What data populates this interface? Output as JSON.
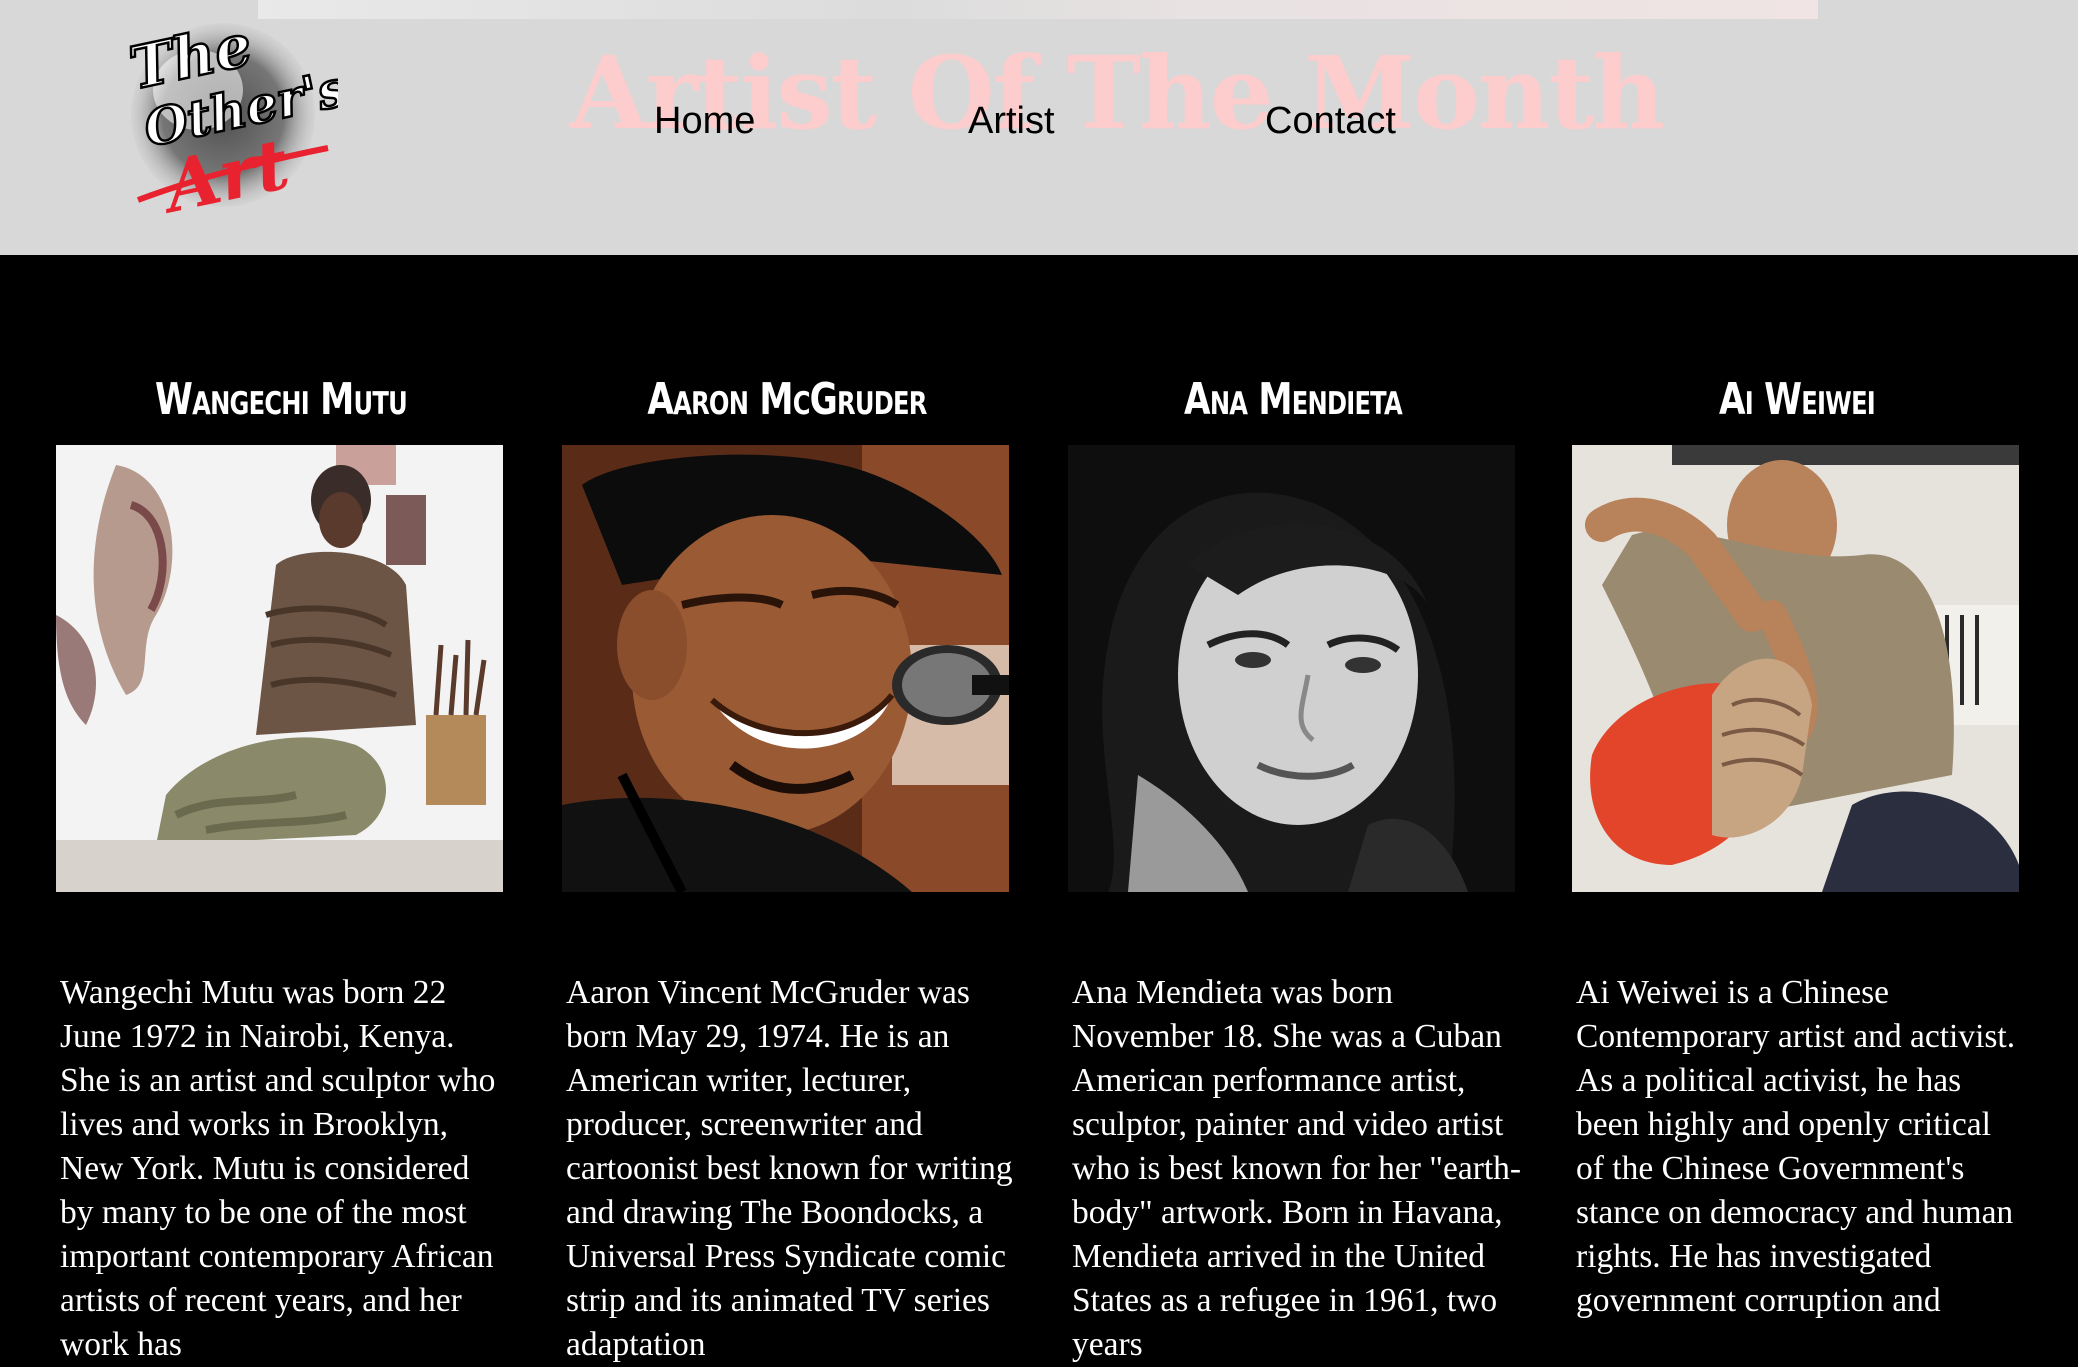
{
  "site": {
    "logo_text": [
      "The",
      "Other's",
      "Art"
    ],
    "ghost_title": "Artist Of The Month"
  },
  "nav": {
    "items": [
      {
        "label": "Home"
      },
      {
        "label": "Artist"
      },
      {
        "label": "Contact"
      }
    ]
  },
  "artists": [
    {
      "name": "Wangechi Mutu",
      "photo_icon": "portrait-photo",
      "bio": "Wangechi Mutu was born 22 June 1972 in Nairobi, Kenya. She is an artist and sculptor who lives and works in Brooklyn, New York. Mutu is considered by many to be one of the most important contemporary African artists of recent years, and her work has"
    },
    {
      "name": "Aaron McGruder",
      "photo_icon": "portrait-photo",
      "bio": "Aaron Vincent McGruder was born May 29, 1974. He is an American writer, lecturer, producer, screenwriter and cartoonist best known for writing and drawing The Boondocks, a Universal Press Syndicate comic strip and its animated TV series adaptation"
    },
    {
      "name": "Ana Mendieta",
      "photo_icon": "portrait-photo",
      "bio": "Ana Mendieta was born November 18. She was a Cuban American performance artist, sculptor, painter and video artist who is best known for her \"earth-body\" artwork. Born in Havana, Mendieta arrived in the United States as a refugee in 1961, two years"
    },
    {
      "name": "Ai Weiwei",
      "photo_icon": "portrait-photo",
      "bio": "Ai Weiwei is a Chinese Contemporary artist and activist. As a political activist, he has been highly and openly critical of the Chinese Government's stance on democracy and human rights. He has investigated government corruption and"
    }
  ]
}
